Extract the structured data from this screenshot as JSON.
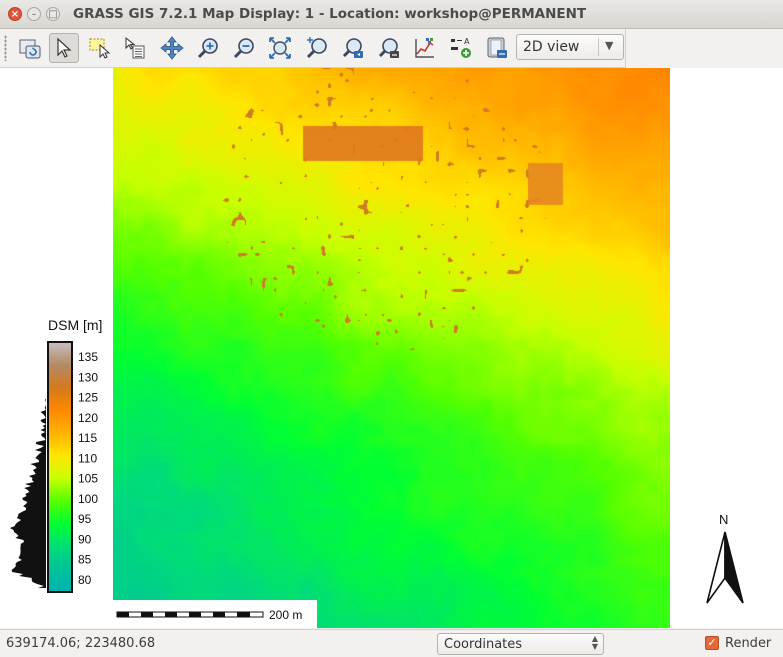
{
  "window": {
    "title": "GRASS GIS 7.2.1 Map Display: 1 - Location: workshop@PERMANENT",
    "controls": {
      "close": "×",
      "minimize": "–",
      "maximize": "□"
    }
  },
  "toolbar": {
    "tools": [
      {
        "name": "render-map-icon",
        "active": false
      },
      {
        "name": "pointer-icon",
        "active": true
      },
      {
        "name": "select-icon",
        "active": false
      },
      {
        "name": "query-icon",
        "active": false
      },
      {
        "name": "pan-icon",
        "active": false
      },
      {
        "name": "zoom-in-icon",
        "active": false
      },
      {
        "name": "zoom-out-icon",
        "active": false
      },
      {
        "name": "zoom-extent-icon",
        "active": false
      },
      {
        "name": "zoom-back-icon",
        "active": false
      },
      {
        "name": "zoom-menu-icon",
        "active": false
      },
      {
        "name": "zoom-region-icon",
        "active": false
      },
      {
        "name": "analyze-icon",
        "active": false
      },
      {
        "name": "overlay-icon",
        "active": false
      },
      {
        "name": "save-image-icon",
        "active": false
      }
    ],
    "view_mode": "2D view"
  },
  "map": {
    "raster_name": "DSM",
    "colors": {
      "min": "#00b7aa",
      "mid_low": "#00ff00",
      "mid": "#ffff00",
      "mid_high": "#ff8c00",
      "high": "#c0c0c0"
    }
  },
  "legend": {
    "title": "DSM [m]",
    "labels": [
      "135",
      "130",
      "125",
      "120",
      "115",
      "110",
      "105",
      "100",
      "95",
      "90",
      "85",
      "80"
    ],
    "gradient": [
      "#c7bfbf",
      "#b48a66",
      "#d37a1c",
      "#ff8800",
      "#ffb300",
      "#ffe600",
      "#c8ff00",
      "#55ff00",
      "#00ff33",
      "#00dd77",
      "#00c39a",
      "#00b3b0"
    ]
  },
  "scalebar": {
    "label": "200 m"
  },
  "north_arrow": {
    "label": "N"
  },
  "statusbar": {
    "coordinates": "639174.06; 223480.68",
    "mode": "Coordinates",
    "render_label": "Render",
    "render_checked": true
  }
}
